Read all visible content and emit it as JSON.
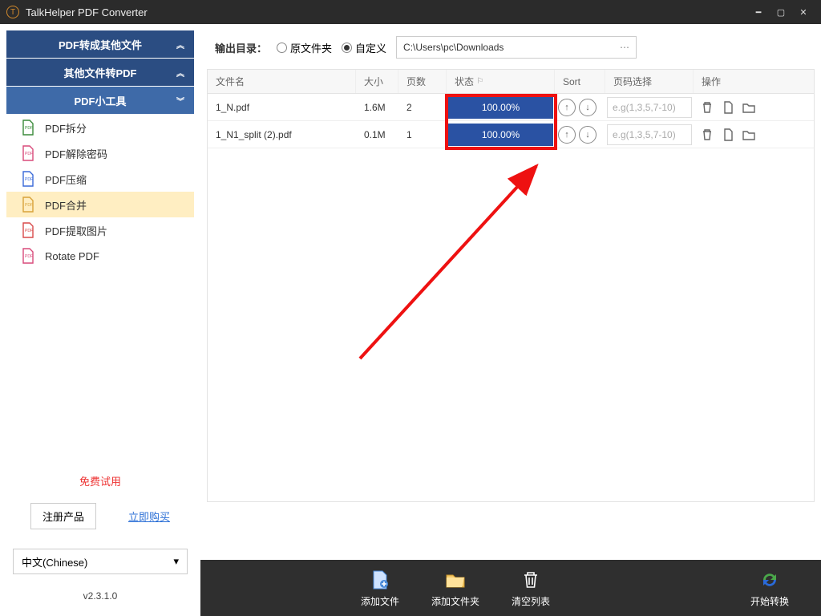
{
  "window": {
    "title": "TalkHelper PDF Converter"
  },
  "sidebar": {
    "sections": [
      {
        "label": "PDF转成其他文件"
      },
      {
        "label": "其他文件转PDF"
      },
      {
        "label": "PDF小工具"
      }
    ],
    "tools": [
      {
        "label": "PDF拆分"
      },
      {
        "label": "PDF解除密码"
      },
      {
        "label": "PDF压缩"
      },
      {
        "label": "PDF合并"
      },
      {
        "label": "PDF提取图片"
      },
      {
        "label": "Rotate PDF"
      }
    ],
    "trial": "免费试用",
    "register": "注册产品",
    "buy": "立即购买",
    "language": "中文(Chinese)",
    "version": "v2.3.1.0"
  },
  "output": {
    "label": "输出目录：",
    "radio_original": "原文件夹",
    "radio_custom": "自定义",
    "path": "C:\\Users\\pc\\Downloads"
  },
  "table": {
    "headers": {
      "filename": "文件名",
      "size": "大小",
      "pages": "页数",
      "status": "状态",
      "sort": "Sort",
      "range": "页码选择",
      "ops": "操作"
    },
    "range_placeholder": "e.g(1,3,5,7-10)",
    "rows": [
      {
        "filename": "1_N.pdf",
        "size": "1.6M",
        "pages": "2",
        "status": "100.00%"
      },
      {
        "filename": "1_N1_split (2).pdf",
        "size": "0.1M",
        "pages": "1",
        "status": "100.00%"
      }
    ]
  },
  "bottombar": {
    "add_file": "添加文件",
    "add_folder": "添加文件夹",
    "clear": "清空列表",
    "start": "开始转换"
  }
}
